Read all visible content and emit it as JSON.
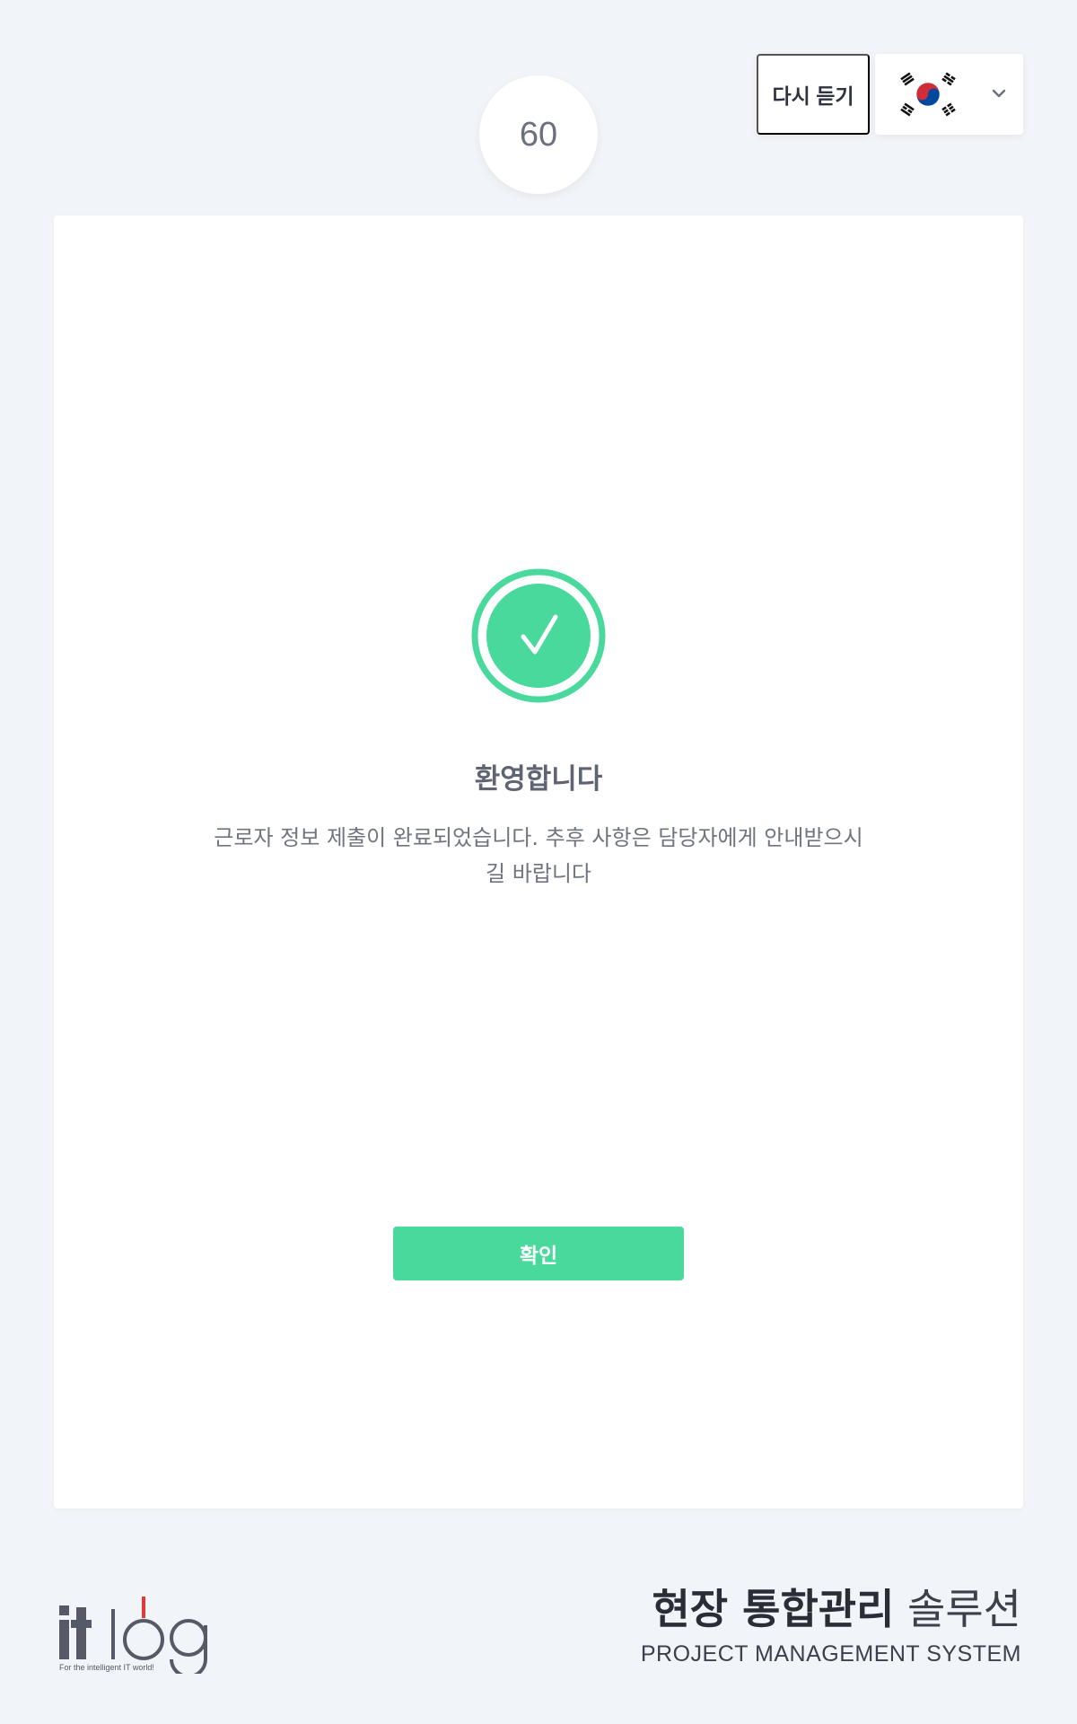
{
  "timer": {
    "seconds": "60"
  },
  "header": {
    "replay_label": "다시 듣기",
    "language": {
      "selected_icon": "south-korea-flag-icon",
      "dropdown_icon": "chevron-down-icon"
    }
  },
  "card": {
    "status_icon": "check-circle-icon",
    "title": "환영합니다",
    "message": "근로자 정보 제출이 완료되었습니다. 추후 사항은 담당자에게 안내받으시길 바랍니다",
    "confirm_label": "확인"
  },
  "footer": {
    "logo_text": "itlog",
    "logo_tagline": "For the intelligent IT world!",
    "brand_strong": "현장 통합관리",
    "brand_light": "솔루션",
    "brand_sub": "PROJECT MANAGEMENT SYSTEM"
  },
  "colors": {
    "accent": "#4ad99c",
    "background": "#f1f4f8",
    "card": "#ffffff",
    "logo_red": "#e03a3a"
  }
}
